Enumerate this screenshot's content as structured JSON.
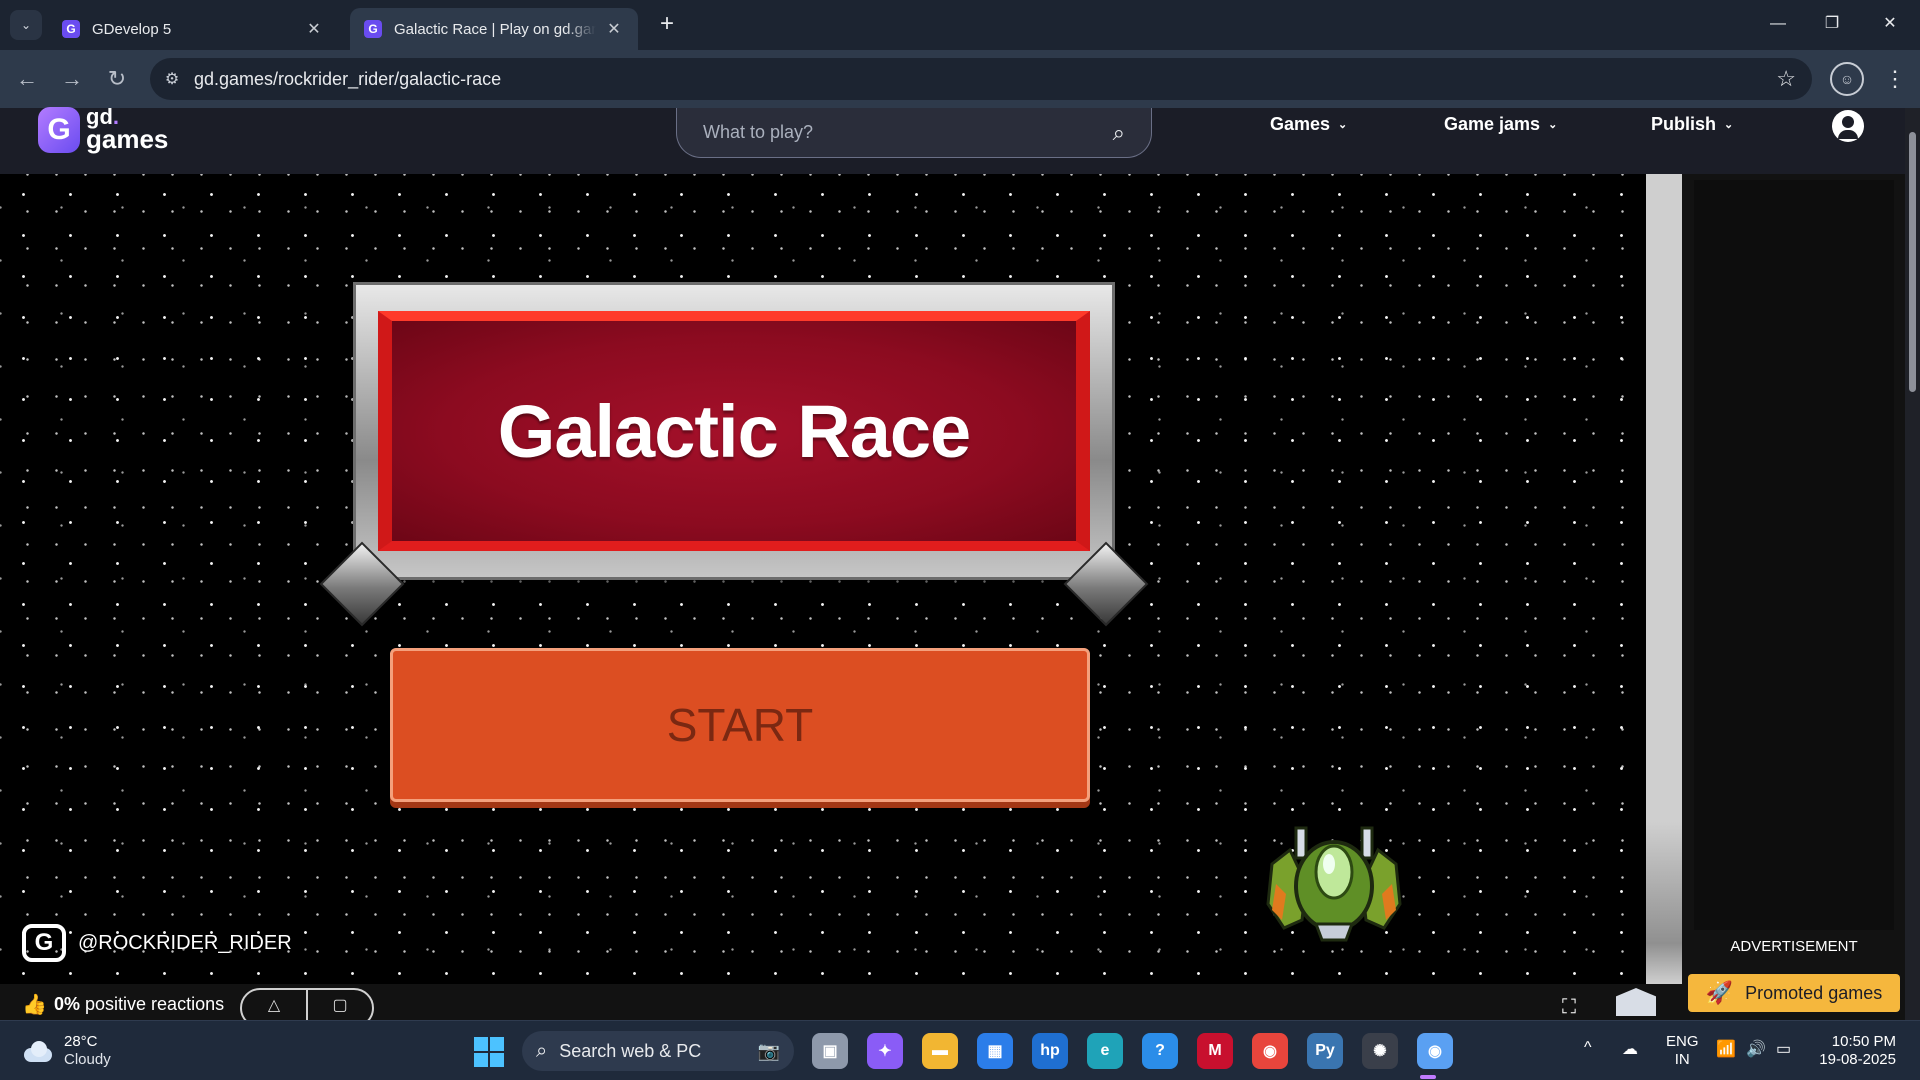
{
  "browser": {
    "tab_list_glyph": "⌄",
    "tabs": [
      {
        "title": "GDevelop 5",
        "favicon": "G",
        "close": "✕"
      },
      {
        "title": "Galactic Race | Play on gd.games",
        "favicon": "G",
        "close": "✕"
      }
    ],
    "new_tab": "+",
    "window_controls": {
      "minimize": "—",
      "restore": "❐",
      "close": "✕"
    },
    "nav": {
      "back": "←",
      "forward": "→",
      "reload": "↻"
    },
    "url": "gd.games/rockrider_rider/galactic-race",
    "site_info_glyph": "⚙",
    "bookmark_glyph": "☆",
    "profile_glyph": "☺",
    "menu_glyph": "⋮"
  },
  "site": {
    "logo_line1": "gd",
    "logo_dot": ".",
    "logo_line2": "games",
    "logo_mark": "G",
    "search_placeholder": "What to play?",
    "search_icon": "⌕",
    "nav": [
      {
        "label": "Games",
        "chevron": "⌄"
      },
      {
        "label": "Game jams",
        "chevron": "⌄"
      },
      {
        "label": "Publish",
        "chevron": "⌄"
      }
    ]
  },
  "game": {
    "title": "Galactic Race",
    "start_label": "START",
    "author": "@ROCKRIDER_RIDER",
    "author_logo": "G"
  },
  "reactions": {
    "percent": "0%",
    "label": " positive reactions",
    "thumb_icon": "👍"
  },
  "sidebar": {
    "ad_label": "ADVERTISEMENT",
    "promoted_label": "Promoted games",
    "promoted_icon": "🚀"
  },
  "taskbar": {
    "weather_temp": "28°C",
    "weather_desc": "Cloudy",
    "search_label": "Search web & PC",
    "search_icon": "⌕",
    "apps": [
      {
        "name": "task-view",
        "color": "#8e99ab",
        "glyph": "▣"
      },
      {
        "name": "copilot",
        "color": "#8a5cf6",
        "glyph": "✦"
      },
      {
        "name": "file-explorer",
        "color": "#f2b632",
        "glyph": "▬"
      },
      {
        "name": "microsoft-store",
        "color": "#2b7de9",
        "glyph": "▦"
      },
      {
        "name": "hp",
        "color": "#1f6fd1",
        "glyph": "hp"
      },
      {
        "name": "edge",
        "color": "#1fa3b8",
        "glyph": "e"
      },
      {
        "name": "settings-helper",
        "color": "#2b8de9",
        "glyph": "?"
      },
      {
        "name": "mcafee",
        "color": "#c8102e",
        "glyph": "M"
      },
      {
        "name": "chrome",
        "color": "#e8453c",
        "glyph": "◉"
      },
      {
        "name": "python",
        "color": "#3a75b0",
        "glyph": "Py"
      },
      {
        "name": "chatgpt",
        "color": "#3a3f4a",
        "glyph": "✺"
      },
      {
        "name": "chrome-profile",
        "color": "#5aa0f2",
        "glyph": "◉"
      }
    ],
    "lang_line1": "ENG",
    "lang_line2": "IN",
    "time": "10:50 PM",
    "date": "19-08-2025",
    "tray_chevron": "^"
  }
}
